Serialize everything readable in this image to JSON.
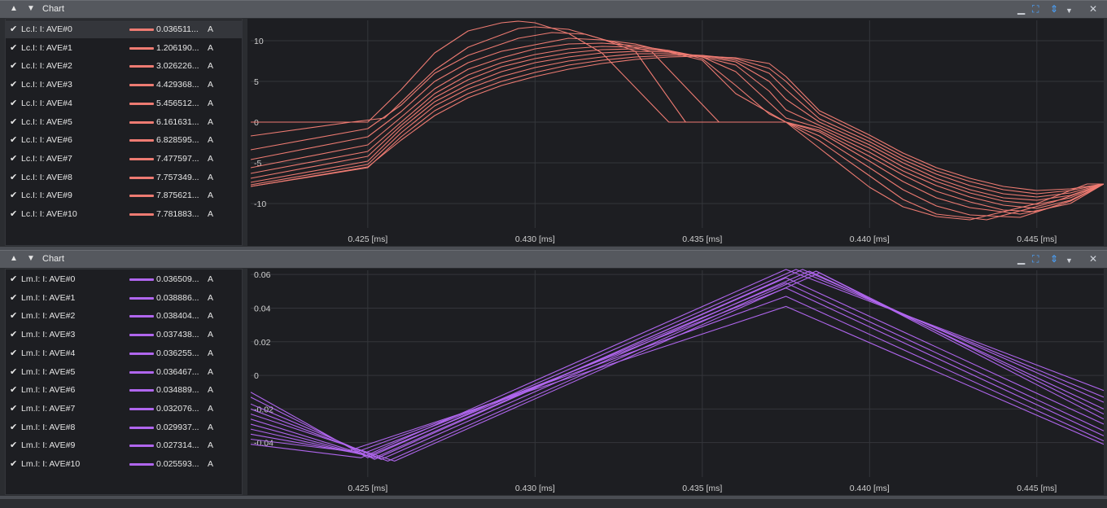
{
  "panels": [
    {
      "title": "Chart",
      "legend": [
        {
          "label": "Lc.I: I: AVE#0",
          "value": "0.036511...",
          "unit": "A",
          "checked": true
        },
        {
          "label": "Lc.I: I: AVE#1",
          "value": "1.206190...",
          "unit": "A",
          "checked": true
        },
        {
          "label": "Lc.I: I: AVE#2",
          "value": "3.026226...",
          "unit": "A",
          "checked": true
        },
        {
          "label": "Lc.I: I: AVE#3",
          "value": "4.429368...",
          "unit": "A",
          "checked": true
        },
        {
          "label": "Lc.I: I: AVE#4",
          "value": "5.456512...",
          "unit": "A",
          "checked": true
        },
        {
          "label": "Lc.I: I: AVE#5",
          "value": "6.161631...",
          "unit": "A",
          "checked": true
        },
        {
          "label": "Lc.I: I: AVE#6",
          "value": "6.828595...",
          "unit": "A",
          "checked": true
        },
        {
          "label": "Lc.I: I: AVE#7",
          "value": "7.477597...",
          "unit": "A",
          "checked": true
        },
        {
          "label": "Lc.I: I: AVE#8",
          "value": "7.757349...",
          "unit": "A",
          "checked": true
        },
        {
          "label": "Lc.I: I: AVE#9",
          "value": "7.875621...",
          "unit": "A",
          "checked": true
        },
        {
          "label": "Lc.I: I: AVE#10",
          "value": "7.781883...",
          "unit": "A",
          "checked": true
        }
      ],
      "color": "#ee7b72",
      "icons": [
        "collapse-up-icon",
        "dropdown-arrow-icon",
        "minimize-icon",
        "fit-icon",
        "autoscale-icon",
        "chevron-down-icon",
        "close-icon"
      ]
    },
    {
      "title": "Chart",
      "legend": [
        {
          "label": "Lm.I: I: AVE#0",
          "value": "0.036509...",
          "unit": "A",
          "checked": true
        },
        {
          "label": "Lm.I: I: AVE#1",
          "value": "0.038886...",
          "unit": "A",
          "checked": true
        },
        {
          "label": "Lm.I: I: AVE#2",
          "value": "0.038404...",
          "unit": "A",
          "checked": true
        },
        {
          "label": "Lm.I: I: AVE#3",
          "value": "0.037438...",
          "unit": "A",
          "checked": true
        },
        {
          "label": "Lm.I: I: AVE#4",
          "value": "0.036255...",
          "unit": "A",
          "checked": true
        },
        {
          "label": "Lm.I: I: AVE#5",
          "value": "0.036467...",
          "unit": "A",
          "checked": true
        },
        {
          "label": "Lm.I: I: AVE#6",
          "value": "0.034889...",
          "unit": "A",
          "checked": true
        },
        {
          "label": "Lm.I: I: AVE#7",
          "value": "0.032076...",
          "unit": "A",
          "checked": true
        },
        {
          "label": "Lm.I: I: AVE#8",
          "value": "0.029937...",
          "unit": "A",
          "checked": true
        },
        {
          "label": "Lm.I: I: AVE#9",
          "value": "0.027314...",
          "unit": "A",
          "checked": true
        },
        {
          "label": "Lm.I: I: AVE#10",
          "value": "0.025593...",
          "unit": "A",
          "checked": true
        }
      ],
      "color": "#b066ee",
      "icons": [
        "collapse-up-icon",
        "dropdown-arrow-icon",
        "minimize-icon",
        "fit-icon",
        "autoscale-icon",
        "chevron-down-icon",
        "close-icon"
      ]
    }
  ],
  "chart_data": [
    {
      "type": "line",
      "xlim": [
        0.4215,
        0.447
      ],
      "ylim": [
        -13,
        12.5
      ],
      "yticks": [
        10,
        5,
        0,
        -5,
        -10
      ],
      "xticks": [
        0.425,
        0.43,
        0.435,
        0.44,
        0.445
      ],
      "xtick_labels": [
        "0.425 [ms]",
        "0.430 [ms]",
        "0.435 [ms]",
        "0.440 [ms]",
        "0.445 [ms]"
      ],
      "grid": true,
      "series": [
        {
          "name": "Lc.I: I: AVE#0",
          "x": [
            0.4215,
            0.425,
            0.426,
            0.427,
            0.428,
            0.429,
            0.4295,
            0.43,
            0.431,
            0.432,
            0.434,
            0.4375,
            0.4385,
            0.44,
            0.441,
            0.442,
            0.443,
            0.445,
            0.4465,
            0.447
          ],
          "y": [
            0,
            0,
            4.0,
            8.5,
            11.2,
            12.2,
            12.4,
            12.2,
            10.9,
            8.5,
            0,
            0,
            -3.2,
            -8.0,
            -10.4,
            -11.6,
            -12.0,
            -10.0,
            -7.6,
            -7.6
          ]
        },
        {
          "name": "Lc.I: I: AVE#1",
          "x": [
            0.4215,
            0.4245,
            0.4255,
            0.427,
            0.428,
            0.4295,
            0.43,
            0.431,
            0.432,
            0.433,
            0.4345,
            0.4375,
            0.4385,
            0.44,
            0.441,
            0.442,
            0.4435,
            0.4455,
            0.447
          ],
          "y": [
            -1.7,
            0,
            0.5,
            6.4,
            9.2,
            11.5,
            11.7,
            11.4,
            10.2,
            8.7,
            0,
            0,
            -2.3,
            -6.6,
            -9.5,
            -11.3,
            -12.0,
            -9.8,
            -7.6
          ]
        },
        {
          "name": "Lc.I: I: AVE#2",
          "x": [
            0.4215,
            0.425,
            0.426,
            0.427,
            0.428,
            0.4295,
            0.4305,
            0.4315,
            0.432,
            0.4335,
            0.4355,
            0.4375,
            0.4385,
            0.44,
            0.441,
            0.442,
            0.443,
            0.4445,
            0.446,
            0.447
          ],
          "y": [
            -3.4,
            -0.8,
            2.1,
            6.0,
            8.2,
            10.3,
            11.0,
            10.8,
            10.2,
            8.6,
            0,
            0,
            -1.7,
            -5.6,
            -8.3,
            -10.3,
            -11.4,
            -11.7,
            -9.7,
            -7.6
          ]
        },
        {
          "name": "Lc.I: I: AVE#3",
          "x": [
            0.4215,
            0.425,
            0.426,
            0.427,
            0.428,
            0.429,
            0.431,
            0.432,
            0.433,
            0.435,
            0.436,
            0.4375,
            0.4385,
            0.44,
            0.441,
            0.442,
            0.443,
            0.4445,
            0.446,
            0.447
          ],
          "y": [
            -4.6,
            -1.8,
            1.3,
            5.0,
            7.3,
            8.7,
            10.3,
            10.1,
            9.6,
            7.6,
            3.5,
            0,
            -1.2,
            -4.8,
            -7.3,
            -9.3,
            -10.5,
            -11.3,
            -10.0,
            -7.6
          ]
        },
        {
          "name": "Lc.I: I: AVE#4",
          "x": [
            0.4215,
            0.425,
            0.426,
            0.427,
            0.428,
            0.429,
            0.43,
            0.431,
            0.432,
            0.433,
            0.434,
            0.435,
            0.436,
            0.437,
            0.4375,
            0.4385,
            0.44,
            0.441,
            0.442,
            0.443,
            0.444,
            0.445,
            0.446,
            0.447
          ],
          "y": [
            -5.6,
            -2.8,
            0.6,
            4.1,
            6.5,
            7.9,
            9.0,
            9.6,
            9.7,
            9.4,
            8.8,
            7.8,
            4.5,
            1.0,
            0,
            -1.0,
            -4.2,
            -6.5,
            -8.5,
            -9.8,
            -10.8,
            -11.0,
            -9.7,
            -7.6
          ]
        },
        {
          "name": "Lc.I: I: AVE#5",
          "x": [
            0.4215,
            0.425,
            0.426,
            0.427,
            0.428,
            0.429,
            0.43,
            0.431,
            0.432,
            0.433,
            0.434,
            0.435,
            0.436,
            0.437,
            0.4375,
            0.4385,
            0.44,
            0.441,
            0.442,
            0.443,
            0.444,
            0.445,
            0.446,
            0.447
          ],
          "y": [
            -6.3,
            -3.6,
            0,
            3.5,
            5.8,
            7.3,
            8.3,
            9.0,
            9.3,
            9.2,
            8.8,
            8.0,
            6.2,
            2.4,
            0.5,
            -0.7,
            -3.7,
            -6.0,
            -7.8,
            -9.2,
            -10.2,
            -10.6,
            -9.6,
            -7.6
          ]
        },
        {
          "name": "Lc.I: I: AVE#6",
          "x": [
            0.4215,
            0.425,
            0.426,
            0.427,
            0.428,
            0.429,
            0.43,
            0.431,
            0.432,
            0.433,
            0.434,
            0.435,
            0.436,
            0.437,
            0.4375,
            0.4385,
            0.44,
            0.441,
            0.442,
            0.443,
            0.444,
            0.445,
            0.446,
            0.447
          ],
          "y": [
            -6.9,
            -4.2,
            -0.4,
            3.0,
            5.2,
            6.8,
            7.8,
            8.5,
            8.9,
            9.0,
            8.7,
            8.0,
            7.0,
            3.8,
            1.5,
            -0.4,
            -3.2,
            -5.5,
            -7.3,
            -8.7,
            -9.7,
            -10.1,
            -9.3,
            -7.6
          ]
        },
        {
          "name": "Lc.I: I: AVE#7",
          "x": [
            0.4215,
            0.425,
            0.426,
            0.427,
            0.428,
            0.429,
            0.43,
            0.431,
            0.432,
            0.433,
            0.434,
            0.435,
            0.436,
            0.437,
            0.4375,
            0.4385,
            0.44,
            0.441,
            0.442,
            0.443,
            0.444,
            0.445,
            0.446,
            0.447
          ],
          "y": [
            -7.4,
            -4.8,
            -0.8,
            2.5,
            4.6,
            6.2,
            7.3,
            8.0,
            8.5,
            8.7,
            8.6,
            8.1,
            7.4,
            5.0,
            2.8,
            0,
            -2.8,
            -5.0,
            -6.9,
            -8.3,
            -9.3,
            -9.6,
            -9.0,
            -7.6
          ]
        },
        {
          "name": "Lc.I: I: AVE#8",
          "x": [
            0.4215,
            0.425,
            0.426,
            0.427,
            0.428,
            0.429,
            0.43,
            0.431,
            0.432,
            0.433,
            0.434,
            0.435,
            0.436,
            0.437,
            0.4375,
            0.4385,
            0.44,
            0.441,
            0.442,
            0.443,
            0.444,
            0.445,
            0.446,
            0.447
          ],
          "y": [
            -7.7,
            -5.2,
            -1.3,
            2.0,
            4.1,
            5.6,
            6.7,
            7.5,
            8.0,
            8.4,
            8.4,
            8.2,
            7.6,
            6.0,
            4.0,
            0.4,
            -2.4,
            -4.6,
            -6.4,
            -7.8,
            -8.8,
            -9.2,
            -8.7,
            -7.6
          ]
        },
        {
          "name": "Lc.I: I: AVE#9",
          "x": [
            0.4215,
            0.425,
            0.426,
            0.427,
            0.428,
            0.429,
            0.43,
            0.431,
            0.432,
            0.433,
            0.434,
            0.435,
            0.436,
            0.437,
            0.4375,
            0.4385,
            0.44,
            0.441,
            0.442,
            0.443,
            0.444,
            0.445,
            0.446,
            0.447
          ],
          "y": [
            -7.9,
            -5.6,
            -1.8,
            1.4,
            3.5,
            5.0,
            6.1,
            7.0,
            7.6,
            8.0,
            8.2,
            8.2,
            7.8,
            6.6,
            5.0,
            1.0,
            -2.0,
            -4.2,
            -6.0,
            -7.3,
            -8.3,
            -8.8,
            -8.4,
            -7.6
          ]
        },
        {
          "name": "Lc.I: I: AVE#10",
          "x": [
            0.4215,
            0.425,
            0.426,
            0.427,
            0.428,
            0.429,
            0.43,
            0.431,
            0.432,
            0.433,
            0.434,
            0.435,
            0.436,
            0.437,
            0.4375,
            0.4385,
            0.44,
            0.441,
            0.442,
            0.443,
            0.444,
            0.445,
            0.446,
            0.447
          ],
          "y": [
            -7.9,
            -5.5,
            -2.2,
            0.8,
            3.0,
            4.5,
            5.6,
            6.5,
            7.2,
            7.7,
            8.0,
            8.1,
            7.9,
            7.2,
            5.6,
            1.4,
            -1.6,
            -3.8,
            -5.6,
            -6.9,
            -7.9,
            -8.4,
            -8.2,
            -7.6
          ]
        }
      ]
    },
    {
      "type": "line",
      "xlim": [
        0.4215,
        0.447
      ],
      "ylim": [
        -0.0605,
        0.0625
      ],
      "yticks": [
        0.06,
        0.04,
        0.02,
        0,
        -0.02,
        -0.04
      ],
      "ytick_labels": [
        "0.06",
        "0.04",
        "0.02",
        "0",
        "-0.02",
        "-0.04"
      ],
      "xticks": [
        0.425,
        0.43,
        0.435,
        0.44,
        0.445
      ],
      "xtick_labels": [
        "0.425 [ms]",
        "0.430 [ms]",
        "0.435 [ms]",
        "0.440 [ms]",
        "0.445 [ms]"
      ],
      "grid": true,
      "series": [
        {
          "name": "Lm.I: I: AVE#0",
          "x": [
            0.4215,
            0.4248,
            0.4375,
            0.447
          ],
          "y": [
            -0.041,
            -0.049,
            0.063,
            -0.009
          ]
        },
        {
          "name": "Lm.I: I: AVE#1",
          "x": [
            0.4215,
            0.425,
            0.4378,
            0.447
          ],
          "y": [
            -0.01,
            -0.049,
            0.063,
            -0.013
          ]
        },
        {
          "name": "Lm.I: I: AVE#2",
          "x": [
            0.4215,
            0.4252,
            0.438,
            0.447
          ],
          "y": [
            -0.013,
            -0.05,
            0.063,
            -0.016
          ]
        },
        {
          "name": "Lm.I: I: AVE#3",
          "x": [
            0.4215,
            0.4254,
            0.4382,
            0.447
          ],
          "y": [
            -0.017,
            -0.05,
            0.062,
            -0.02
          ]
        },
        {
          "name": "Lm.I: I: AVE#4",
          "x": [
            0.4215,
            0.4256,
            0.4384,
            0.447
          ],
          "y": [
            -0.02,
            -0.051,
            0.062,
            -0.023
          ]
        },
        {
          "name": "Lm.I: I: AVE#5",
          "x": [
            0.4215,
            0.4258,
            0.4385,
            0.447
          ],
          "y": [
            -0.023,
            -0.051,
            0.061,
            -0.026
          ]
        },
        {
          "name": "Lm.I: I: AVE#6",
          "x": [
            0.4215,
            0.4252,
            0.4375,
            0.447
          ],
          "y": [
            -0.026,
            -0.049,
            0.058,
            -0.029
          ]
        },
        {
          "name": "Lm.I: I: AVE#7",
          "x": [
            0.4215,
            0.425,
            0.4375,
            0.447
          ],
          "y": [
            -0.029,
            -0.048,
            0.055,
            -0.033
          ]
        },
        {
          "name": "Lm.I: I: AVE#8",
          "x": [
            0.4215,
            0.4248,
            0.4375,
            0.447
          ],
          "y": [
            -0.032,
            -0.047,
            0.052,
            -0.036
          ]
        },
        {
          "name": "Lm.I: I: AVE#9",
          "x": [
            0.4215,
            0.4246,
            0.4375,
            0.447
          ],
          "y": [
            -0.035,
            -0.046,
            0.047,
            -0.039
          ]
        },
        {
          "name": "Lm.I: I: AVE#10",
          "x": [
            0.4215,
            0.4244,
            0.4375,
            0.447
          ],
          "y": [
            -0.038,
            -0.045,
            0.041,
            -0.041
          ]
        }
      ]
    }
  ]
}
